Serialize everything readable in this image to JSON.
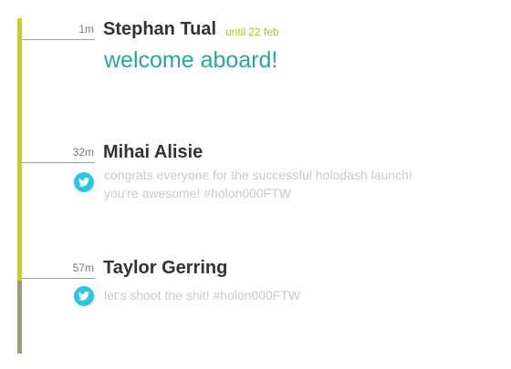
{
  "colors": {
    "timeline_top": "#c9cf2a",
    "timeline_bottom": "#9c9c72",
    "accent_teal": "#28a89a",
    "until_green": "#a6c91c",
    "twitter_blue": "#2bc6e6",
    "message_gray": "#cacaca"
  },
  "entries": [
    {
      "age": "1m",
      "name": "Stephan Tual",
      "until": "until 22 feb",
      "headline": "welcome aboard!"
    },
    {
      "age": "32m",
      "name": "Mihai Alisie",
      "icon": "twitter-bird-icon",
      "message_line1": "congrats everyone for the successful holodash launch!",
      "message_line2": "you're awesome! #holon000FTW"
    },
    {
      "age": "57m",
      "name": "Taylor Gerring",
      "icon": "twitter-bird-icon",
      "message_line1": "let's shoot the shit! #holon000FTW"
    }
  ]
}
